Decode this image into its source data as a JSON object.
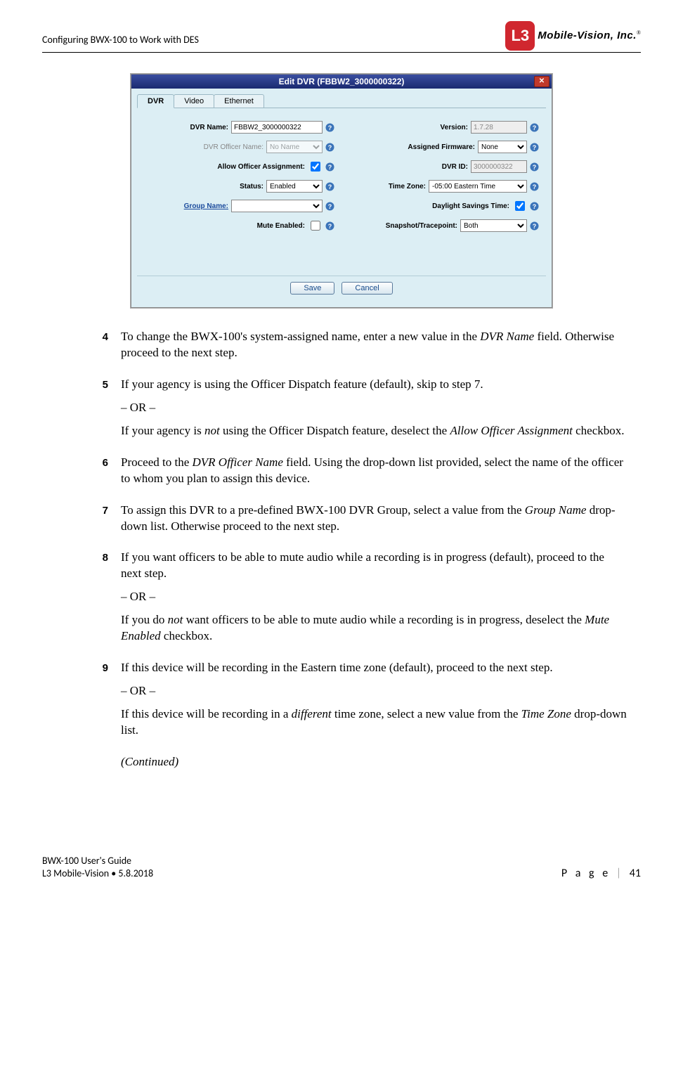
{
  "header": {
    "title": "Configuring BWX-100 to Work with DES",
    "logo_text": "Mobile-Vision, Inc.",
    "logo_mark": "L3",
    "logo_reg": "®"
  },
  "dialog": {
    "title": "Edit DVR (FBBW2_3000000322)",
    "tabs": {
      "dvr": "DVR",
      "video": "Video",
      "ethernet": "Ethernet"
    },
    "labels": {
      "dvr_name": "DVR Name:",
      "dvr_officer_name": "DVR Officer Name:",
      "allow_officer": "Allow Officer Assignment:",
      "status": "Status:",
      "group_name": "Group Name:",
      "mute_enabled": "Mute Enabled:",
      "version": "Version:",
      "assigned_firmware": "Assigned Firmware:",
      "dvr_id": "DVR ID:",
      "time_zone": "Time Zone:",
      "dst": "Daylight Savings Time:",
      "snapshot": "Snapshot/Tracepoint:"
    },
    "values": {
      "dvr_name": "FBBW2_3000000322",
      "dvr_officer_name": "No Name",
      "allow_officer": true,
      "status": "Enabled",
      "group_name": "",
      "mute_enabled": false,
      "version": "1.7.28",
      "assigned_firmware": "None",
      "dvr_id": "3000000322",
      "time_zone": "-05:00 Eastern Time",
      "dst": true,
      "snapshot": "Both"
    },
    "buttons": {
      "save": "Save",
      "cancel": "Cancel"
    }
  },
  "steps": {
    "s4": {
      "num": "4",
      "p1a": "To change the BWX-100's system-assigned name, enter a new value in the ",
      "p1b": "DVR Name",
      "p1c": " field. Otherwise proceed to the next step."
    },
    "s5": {
      "num": "5",
      "p1": "If your agency is using the Officer Dispatch feature (default), skip to step 7.",
      "or": "– OR –",
      "p2a": "If your agency is ",
      "p2b": "not",
      "p2c": " using the Officer Dispatch feature, deselect the ",
      "p2d": "Allow Officer Assignment",
      "p2e": " checkbox."
    },
    "s6": {
      "num": "6",
      "p1a": "Proceed to the ",
      "p1b": "DVR Officer Name",
      "p1c": " field. Using the drop-down list provided, select the name of the officer to whom you plan to assign this device."
    },
    "s7": {
      "num": "7",
      "p1a": "To assign this DVR to a pre-defined BWX-100 DVR Group, select a value from the ",
      "p1b": "Group Name",
      "p1c": " drop-down list. Otherwise proceed to the next step."
    },
    "s8": {
      "num": "8",
      "p1": "If you want officers to be able to mute audio while a recording is in progress (default), proceed to the next step.",
      "or": "– OR –",
      "p2a": "If you do ",
      "p2b": "not",
      "p2c": " want officers to be able to mute audio while a recording is in progress, deselect the ",
      "p2d": "Mute Enabled",
      "p2e": " checkbox."
    },
    "s9": {
      "num": "9",
      "p1": "If this device will be recording in the Eastern time zone (default), proceed to the next step.",
      "or": "– OR –",
      "p2a": "If this device will be recording in a ",
      "p2b": "different",
      "p2c": " time zone, select a new value from the ",
      "p2d": "Time Zone",
      "p2e": " drop-down list."
    },
    "continued": "(Continued)"
  },
  "footer": {
    "line1": "BWX-100 User's Guide",
    "line2_left": "L3 Mobile-Vision ",
    "bullet": "•",
    "line2_right": " 5.8.2018",
    "page_label": "P a g e",
    "sep": "|",
    "page_num": "41"
  }
}
